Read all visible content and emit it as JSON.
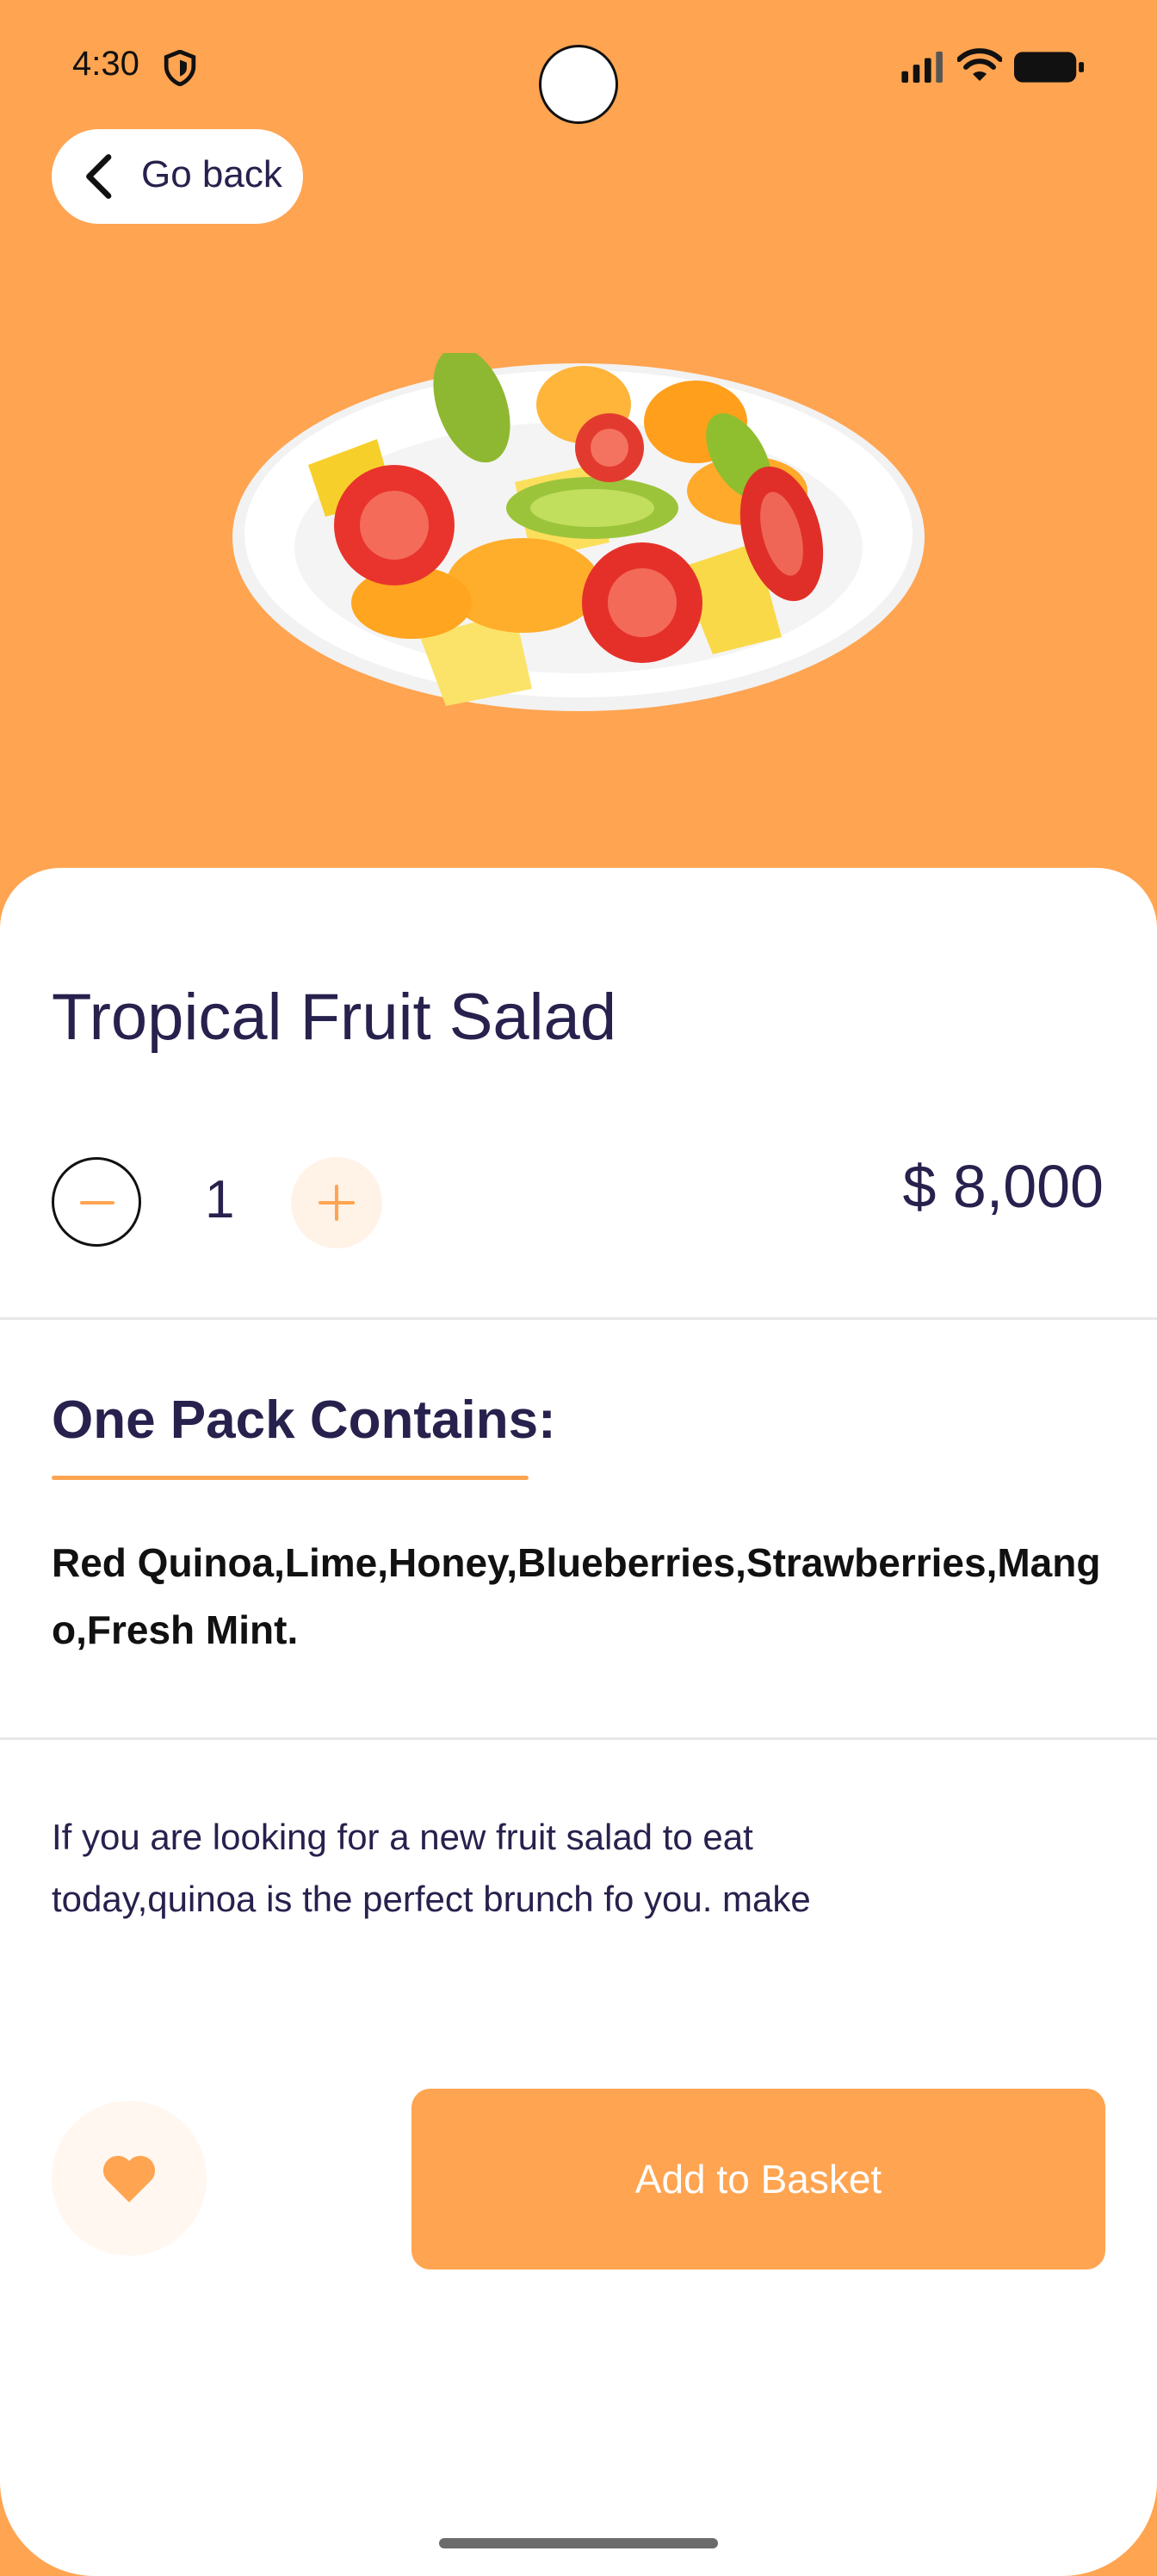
{
  "status_bar": {
    "time": "4:30"
  },
  "nav": {
    "go_back_label": "Go back"
  },
  "product": {
    "title": "Tropical Fruit Salad",
    "quantity": "1",
    "price": "$ 8,000",
    "contains_heading": "One Pack Contains:",
    "contains_list": "Red Quinoa,Lime,Honey,Blueberries,Strawberries,Mango,Fresh Mint.",
    "description": "If you are looking for a new fruit salad to eat today,quinoa is the perfect brunch fo you. make"
  },
  "actions": {
    "add_to_basket_label": "Add to Basket"
  },
  "colors": {
    "accent": "#ffa451",
    "heading": "#27214d"
  }
}
